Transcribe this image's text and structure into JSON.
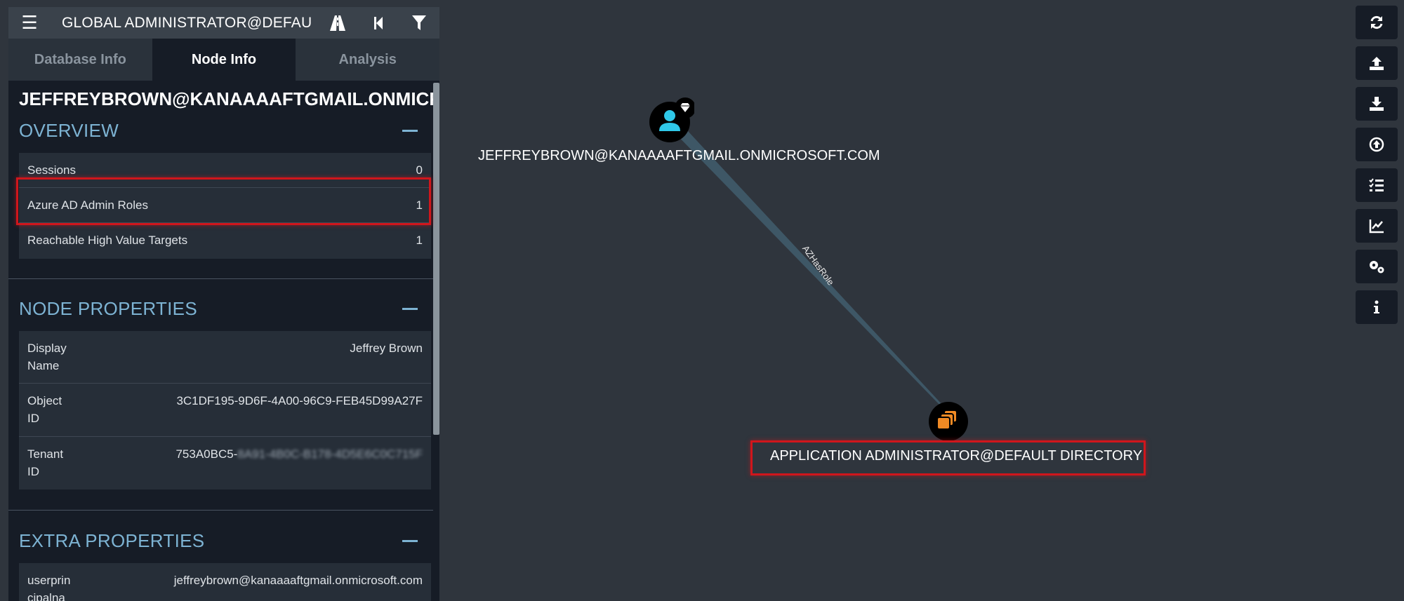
{
  "search": {
    "text": "GLOBAL ADMINISTRATOR@DEFAU"
  },
  "topbar": {
    "menu_icon": "hamburger-icon",
    "pathfinding_icon": "road-icon",
    "back_icon": "step-back-icon",
    "filter_icon": "filter-icon"
  },
  "tabs": [
    {
      "label": "Database Info"
    },
    {
      "label": "Node Info"
    },
    {
      "label": "Analysis"
    }
  ],
  "node": {
    "title": "JEFFREYBROWN@KANAAAAFTGMAIL.ONMICROSOFT.COM"
  },
  "overview": {
    "title": "OVERVIEW",
    "rows": [
      {
        "label": "Sessions",
        "value": "0"
      },
      {
        "label": "Azure AD Admin Roles",
        "value": "1"
      },
      {
        "label": "Reachable High Value Targets",
        "value": "1"
      }
    ]
  },
  "node_properties": {
    "title": "NODE PROPERTIES",
    "rows": [
      {
        "label1": "Display",
        "label2": "Name",
        "value": "Jeffrey Brown"
      },
      {
        "label1": "Object",
        "label2": "ID",
        "value": "3C1DF195-9D6F-4A00-96C9-FEB45D99A27F"
      },
      {
        "label1": "Tenant",
        "label2": "ID",
        "value_visible": "753A0BC5-",
        "value_blurred": "8A91-4B0C-B178-4D5E6C0C715F"
      }
    ]
  },
  "extra_properties": {
    "title": "EXTRA PROPERTIES",
    "rows": [
      {
        "label1": "userprin",
        "label2": "cipalna",
        "value": "jeffreybrown@kanaaaaftgmail.onmicrosoft.com"
      }
    ]
  },
  "graph": {
    "user_node": {
      "label": "JEFFREYBROWN@KANAAAAFTGMAIL.ONMICROSOFT.COM",
      "icon": "user-icon",
      "badge": "diamond-icon",
      "color": "#2fc8e8"
    },
    "role_node": {
      "label": "APPLICATION ADMINISTRATOR@DEFAULT DIRECTORY",
      "icon": "role-icon",
      "color": "#f08a24"
    },
    "edge": {
      "label": "AZHasRole"
    }
  },
  "right_toolbar": [
    {
      "name": "refresh-icon"
    },
    {
      "name": "upload-icon"
    },
    {
      "name": "download-icon"
    },
    {
      "name": "import-icon"
    },
    {
      "name": "queries-list-icon"
    },
    {
      "name": "chart-icon"
    },
    {
      "name": "settings-icon"
    },
    {
      "name": "info-icon"
    }
  ],
  "colors": {
    "highlight": "#d0161c",
    "accent": "#7db3d3",
    "background": "#2f353d",
    "panel": "#161c26"
  }
}
